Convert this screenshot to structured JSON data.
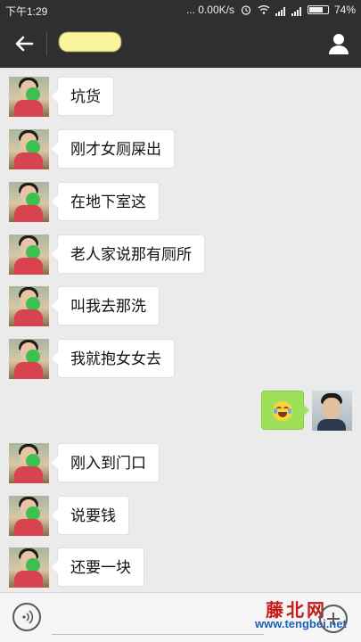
{
  "status_bar": {
    "time": "下午1:29",
    "network_speed": "... 0.00K/s",
    "battery_percent": "74%",
    "battery_level": 0.74,
    "icons": [
      "alarm-icon",
      "wifi-icon",
      "signal-icon",
      "signal-icon",
      "battery-icon"
    ]
  },
  "header": {
    "title": "",
    "back_icon": "arrow-left-icon",
    "profile_icon": "person-icon"
  },
  "messages": [
    {
      "side": "left",
      "text": "坑货"
    },
    {
      "side": "left",
      "text": "刚才女厕屎出"
    },
    {
      "side": "left",
      "text": "在地下室这"
    },
    {
      "side": "left",
      "text": "老人家说那有厕所"
    },
    {
      "side": "left",
      "text": "叫我去那洗"
    },
    {
      "side": "left",
      "text": "我就抱女女去"
    },
    {
      "side": "right",
      "text": "",
      "emoji": "laughing-tears-emoji-icon"
    },
    {
      "side": "left",
      "text": "刚入到门口"
    },
    {
      "side": "left",
      "text": "说要钱"
    },
    {
      "side": "left",
      "text": "还要一块"
    }
  ],
  "input_bar": {
    "voice_icon": "voice-icon",
    "plus_icon": "plus-icon"
  },
  "watermark": {
    "logo": "藤北网",
    "url": "www.tengbei.net"
  },
  "colors": {
    "bar": "#2f2f2f",
    "background": "#ebebeb",
    "my_bubble": "#9fe05a",
    "their_bubble": "#ffffff"
  }
}
